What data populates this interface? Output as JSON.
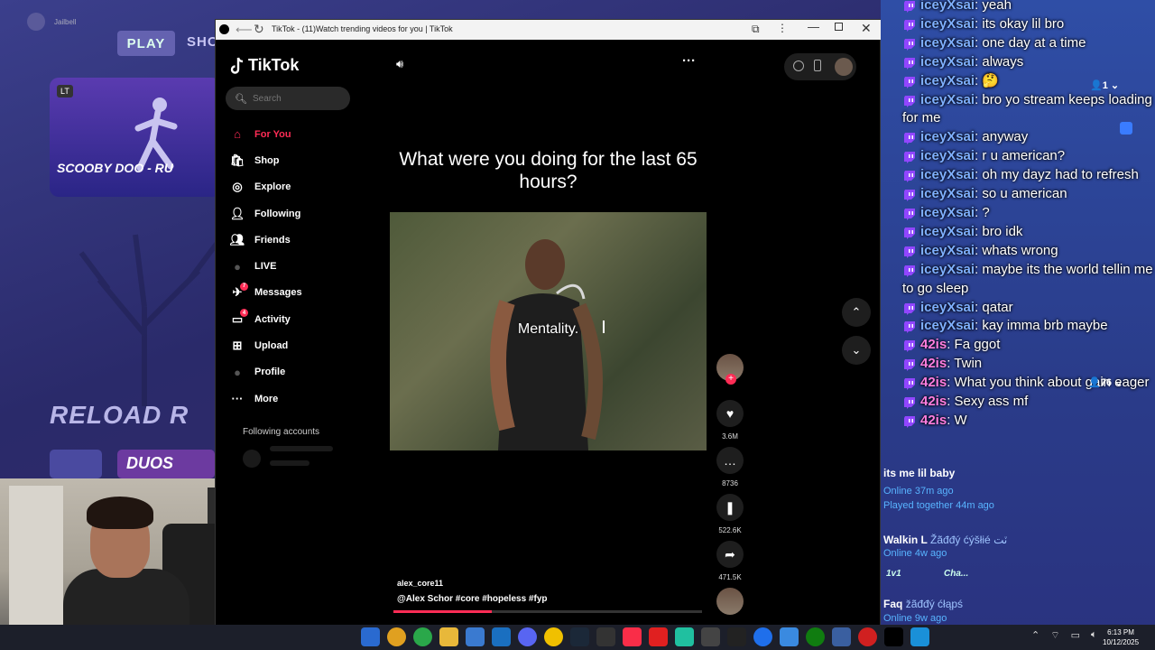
{
  "game": {
    "play_label": "PLAY",
    "shop_label": "SHO",
    "event_badge": "LT",
    "event_title": "SCOOBY DOO - RU",
    "reload_title": "RELOAD R",
    "duos_label": "DUOS",
    "nav_label1": "Jailbell"
  },
  "browser": {
    "title": "TikTok - (11)Watch trending videos for you | TikTok"
  },
  "tiktok": {
    "logo": "TikTok",
    "search_placeholder": "Search",
    "nav": [
      {
        "label": "For You",
        "icon": "home-icon",
        "active": true
      },
      {
        "label": "Shop",
        "icon": "shop-icon"
      },
      {
        "label": "Explore",
        "icon": "explore-icon"
      },
      {
        "label": "Following",
        "icon": "following-icon"
      },
      {
        "label": "Friends",
        "icon": "friends-icon"
      },
      {
        "label": "LIVE",
        "icon": "live-icon"
      },
      {
        "label": "Messages",
        "icon": "messages-icon",
        "badge": "7"
      },
      {
        "label": "Activity",
        "icon": "activity-icon",
        "badge": "4"
      },
      {
        "label": "Upload",
        "icon": "upload-icon"
      },
      {
        "label": "Profile",
        "icon": "profile-icon"
      },
      {
        "label": "More",
        "icon": "more-icon"
      }
    ],
    "following_header": "Following accounts",
    "video": {
      "caption_top": "What were you doing for the last 65 hours?",
      "overlay_text": "Mentality.",
      "author": "alex_core11",
      "description": "@Alex Schor #core #hopeless #fyp",
      "progress": 0.32
    },
    "actions": {
      "likes": "3.6M",
      "comments": "8736",
      "bookmarks": "522.6K",
      "shares": "471.5K"
    }
  },
  "chat": {
    "messages": [
      {
        "user": "iceyXsai",
        "text": "yeah",
        "color": "blue"
      },
      {
        "user": "iceyXsai",
        "text": "its okay lil bro",
        "color": "blue"
      },
      {
        "user": "iceyXsai",
        "text": "one day at a time",
        "color": "blue"
      },
      {
        "user": "iceyXsai",
        "text": "always",
        "color": "blue"
      },
      {
        "user": "iceyXsai",
        "text": "🤔",
        "color": "blue"
      },
      {
        "user": "iceyXsai",
        "text": "bro yo stream keeps loading for me",
        "color": "blue"
      },
      {
        "user": "iceyXsai",
        "text": "anyway",
        "color": "blue"
      },
      {
        "user": "iceyXsai",
        "text": "r u american?",
        "color": "blue"
      },
      {
        "user": "iceyXsai",
        "text": "oh my dayz had to refresh",
        "color": "blue"
      },
      {
        "user": "iceyXsai",
        "text": "so u american",
        "color": "blue"
      },
      {
        "user": "iceyXsai",
        "text": "?",
        "color": "blue"
      },
      {
        "user": "iceyXsai",
        "text": "bro idk",
        "color": "blue"
      },
      {
        "user": "iceyXsai",
        "text": "whats wrong",
        "color": "blue"
      },
      {
        "user": "iceyXsai",
        "text": "maybe its the world tellin me to go sleep",
        "color": "blue"
      },
      {
        "user": "iceyXsai",
        "text": "qatar",
        "color": "blue"
      },
      {
        "user": "iceyXsai",
        "text": "kay imma brb maybe",
        "color": "blue"
      },
      {
        "user": "42is",
        "text": "Fa ggot",
        "color": "pink"
      },
      {
        "user": "42is",
        "text": "Twin",
        "color": "pink"
      },
      {
        "user": "42is",
        "text": "What you think about gain eager",
        "color": "pink"
      },
      {
        "user": "42is",
        "text": "Sexy ass mf",
        "color": "pink"
      },
      {
        "user": "42is",
        "text": "W",
        "color": "pink"
      }
    ],
    "counts": {
      "c1": "1",
      "c2": "76"
    },
    "friends": [
      {
        "name": "its me lil baby",
        "status": "Online 37m ago",
        "sub": "Played together 44m ago"
      },
      {
        "name": "Walkin L",
        "extra": "Žãđđý ćýšłié ٽت",
        "status": "Online 4w ago",
        "tags": [
          "1v1",
          "Cha..."
        ]
      },
      {
        "name": "Faq",
        "extra": "žãđđý ćłąpś",
        "status": "Online 9w ago"
      }
    ]
  },
  "taskbar": {
    "time": "6:13 PM",
    "date": "10/12/2025"
  }
}
